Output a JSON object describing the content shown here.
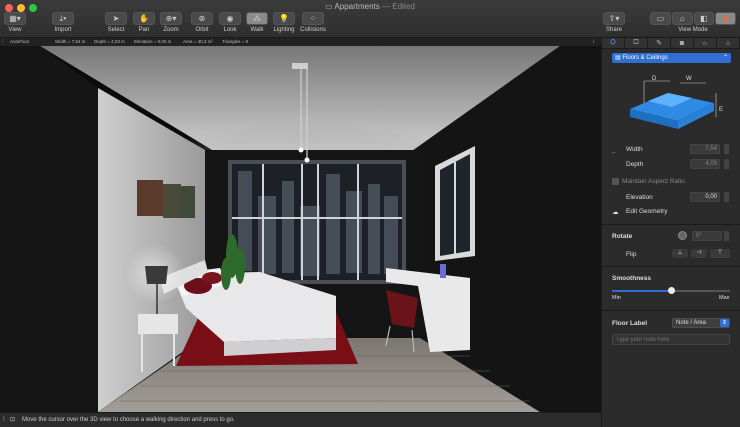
{
  "window": {
    "title": "Appartments",
    "status": "— Edited"
  },
  "toolbar": {
    "view": "View",
    "import": "Import",
    "select": "Select",
    "pan": "Pan",
    "zoom": "Zoom",
    "orbit": "Orbit",
    "look": "Look",
    "walk": "Walk",
    "lighting": "Lighting",
    "collisions": "Collisions",
    "share": "Share",
    "view_mode": "View Mode"
  },
  "infobar": {
    "name": "AutoFloor",
    "width": "Width = 7,54 m",
    "depth": "Depth = 4,03 m",
    "elevation": "Elevation = 0,00 m",
    "area": "Area = 30,3 m²",
    "triangles": "Triangles = 8"
  },
  "status": {
    "message": "Move the cursor over the 3D view to choose a walking direction and press to go."
  },
  "inspector": {
    "category": "Floors & Ceilings",
    "diagram": {
      "d": "D",
      "w": "W",
      "e": "E"
    },
    "width_label": "Width",
    "width_value": "7,54",
    "depth_label": "Depth",
    "depth_value": "4,03",
    "aspect_label": "Maintain Aspect Ratio",
    "elevation_label": "Elevation",
    "elevation_value": "0,00",
    "edit_geometry": "Edit Geometry",
    "rotate_label": "Rotate",
    "rotate_value": "0°",
    "flip_label": "Flip",
    "smoothness_label": "Smoothness",
    "smoothness_value": 0.5,
    "min_label": "Min",
    "max_label": "Max",
    "floor_label": "Floor Label",
    "floor_label_value": "Note / Area",
    "note_placeholder": "Type your note here"
  },
  "colors": {
    "accent": "#2f6fd1",
    "blue_tab": "#4fa3ff",
    "carpet": "#7a0e16"
  }
}
